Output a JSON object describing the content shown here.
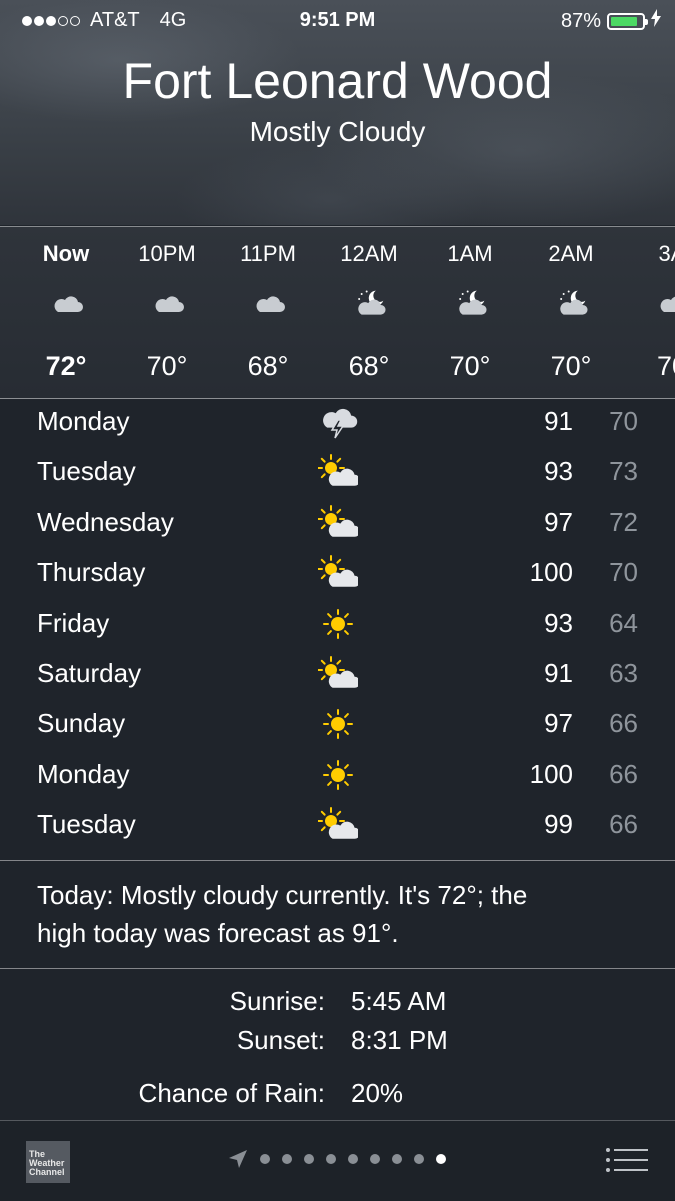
{
  "status_bar": {
    "carrier": "AT&T",
    "network": "4G",
    "time": "9:51 PM",
    "battery_percent": "87%",
    "battery_level": 0.87,
    "signal_bars": 3,
    "signal_total": 5
  },
  "header": {
    "city": "Fort Leonard Wood",
    "condition": "Mostly Cloudy"
  },
  "hourly": [
    {
      "time": "Now",
      "icon": "cloud-icon",
      "temp": "72°"
    },
    {
      "time": "10PM",
      "icon": "cloud-icon",
      "temp": "70°"
    },
    {
      "time": "11PM",
      "icon": "cloud-icon",
      "temp": "68°"
    },
    {
      "time": "12AM",
      "icon": "moon-cloud-icon",
      "temp": "68°"
    },
    {
      "time": "1AM",
      "icon": "moon-cloud-icon",
      "temp": "70°"
    },
    {
      "time": "2AM",
      "icon": "moon-cloud-icon",
      "temp": "70°"
    },
    {
      "time": "3A",
      "icon": "cloud-icon",
      "temp": "70"
    }
  ],
  "daily": [
    {
      "day": "Monday",
      "icon": "thunderstorm-icon",
      "high": "91",
      "low": "70"
    },
    {
      "day": "Tuesday",
      "icon": "partly-sunny-icon",
      "high": "93",
      "low": "73"
    },
    {
      "day": "Wednesday",
      "icon": "partly-sunny-icon",
      "high": "97",
      "low": "72"
    },
    {
      "day": "Thursday",
      "icon": "partly-sunny-icon",
      "high": "100",
      "low": "70"
    },
    {
      "day": "Friday",
      "icon": "sun-icon",
      "high": "93",
      "low": "64"
    },
    {
      "day": "Saturday",
      "icon": "partly-sunny-icon",
      "high": "91",
      "low": "63"
    },
    {
      "day": "Sunday",
      "icon": "sun-icon",
      "high": "97",
      "low": "66"
    },
    {
      "day": "Monday",
      "icon": "sun-icon",
      "high": "100",
      "low": "66"
    },
    {
      "day": "Tuesday",
      "icon": "partly-sunny-icon",
      "high": "99",
      "low": "66"
    }
  ],
  "summary": {
    "line1": "Today: Mostly cloudy currently. It's 72°; the",
    "line2": "high today was forecast as 91°."
  },
  "details": {
    "sunrise_label": "Sunrise:",
    "sunrise": "5:45 AM",
    "sunset_label": "Sunset:",
    "sunset": "8:31 PM",
    "rain_label": "Chance of Rain:",
    "rain": "20%"
  },
  "bottom_bar": {
    "logo_line1": "The",
    "logo_line2": "Weather",
    "logo_line3": "Channel",
    "page_count": 9,
    "active_page": 9
  },
  "colors": {
    "background": "#1f242b",
    "battery_fill": "#4cd964",
    "sun": "#ffcc00",
    "low_temp": "#8f959c"
  }
}
